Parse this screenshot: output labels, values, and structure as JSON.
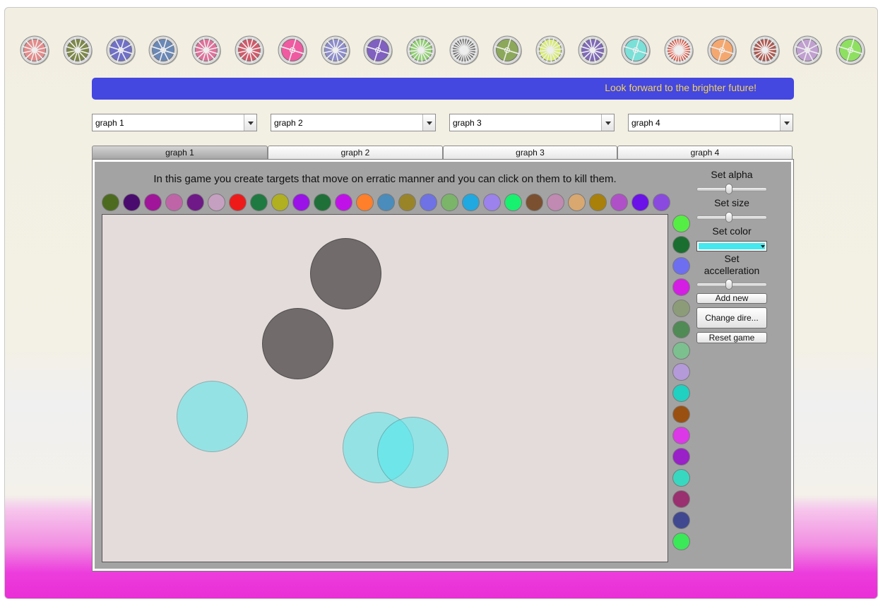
{
  "wheels": [
    {
      "icon": "wheel-icon",
      "color": "#e58a8a",
      "spokes": 6
    },
    {
      "icon": "wheel-icon",
      "color": "#7d8848",
      "spokes": 6
    },
    {
      "icon": "wheel-icon",
      "color": "#7070c7",
      "spokes": 4
    },
    {
      "icon": "wheel-icon",
      "color": "#6a88b5",
      "spokes": 4
    },
    {
      "icon": "wheel-icon",
      "color": "#e0709a",
      "spokes": 6
    },
    {
      "icon": "wheel-icon",
      "color": "#d05a6a",
      "spokes": 6
    },
    {
      "icon": "wheel-icon",
      "color": "#f05aa0",
      "spokes": 2
    },
    {
      "icon": "wheel-icon",
      "color": "#8c8ccc",
      "spokes": 6
    },
    {
      "icon": "wheel-icon",
      "color": "#8060c0",
      "spokes": 2
    },
    {
      "icon": "wheel-icon",
      "color": "#8fd070",
      "spokes": 8
    },
    {
      "icon": "wheel-icon",
      "color": "#777777",
      "spokes": 12
    },
    {
      "icon": "wheel-icon",
      "color": "#8ca85a",
      "spokes": 2
    },
    {
      "icon": "wheel-icon",
      "color": "#d8ec70",
      "spokes": 8
    },
    {
      "icon": "wheel-icon",
      "color": "#7f6ab8",
      "spokes": 6
    },
    {
      "icon": "wheel-icon",
      "color": "#7ae0d8",
      "spokes": 2
    },
    {
      "icon": "wheel-icon",
      "color": "#e25a48",
      "spokes": 12
    },
    {
      "icon": "wheel-icon",
      "color": "#f4a870",
      "spokes": 2
    },
    {
      "icon": "wheel-icon",
      "color": "#b05a50",
      "spokes": 8
    },
    {
      "icon": "wheel-icon",
      "color": "#c0a0d0",
      "spokes": 4
    },
    {
      "icon": "wheel-icon",
      "color": "#8ee060",
      "spokes": 2
    }
  ],
  "banner": {
    "text": "Look forward to the brighter future!",
    "bg": "#4447e0",
    "fg": "#f2d25a"
  },
  "combos": [
    {
      "value": "graph 1"
    },
    {
      "value": "graph 2"
    },
    {
      "value": "graph 3"
    },
    {
      "value": "graph 4"
    }
  ],
  "tabs": [
    {
      "label": "graph 1",
      "active": true
    },
    {
      "label": "graph 2",
      "active": false
    },
    {
      "label": "graph 3",
      "active": false
    },
    {
      "label": "graph 4",
      "active": false
    }
  ],
  "game": {
    "instructions": "In this game you create targets that move on erratic manner and you can click on them to kill them.",
    "top_palette": [
      "#4d6b1f",
      "#4a0b6e",
      "#a0159a",
      "#c064a8",
      "#6f1888",
      "#c6a0c0",
      "#ee1a1a",
      "#1e7a40",
      "#b0b020",
      "#9a12e8",
      "#1e7038",
      "#c012e8",
      "#ff7f2a",
      "#4a8cbc",
      "#9a8428",
      "#6e72e4",
      "#7ab56a",
      "#20a8e0",
      "#9c82ec",
      "#18f070",
      "#7a5030",
      "#c08ab2",
      "#d8a870",
      "#a8800a",
      "#b050c8",
      "#6a12e8",
      "#8a4ae0"
    ],
    "side_palette": [
      "#55ee44",
      "#1a6e30",
      "#6e6ef0",
      "#d41ee4",
      "#8c9c78",
      "#508a55",
      "#7cc090",
      "#b49ad8",
      "#20d0c0",
      "#9a5010",
      "#dc38e8",
      "#9a20c8",
      "#38d8c0",
      "#9a3070",
      "#404890",
      "#3ae858"
    ],
    "targets": [
      {
        "color": "#716b6b",
        "alpha": 1.0
      },
      {
        "color": "#716b6b",
        "alpha": 1.0
      },
      {
        "color": "#48e8ee",
        "alpha": 0.5
      },
      {
        "color": "#48e8ee",
        "alpha": 0.5
      },
      {
        "color": "#48e8ee",
        "alpha": 0.5
      }
    ]
  },
  "controls": {
    "alpha_label": "Set alpha",
    "alpha_level": 0.45,
    "size_label": "Set size",
    "size_level": 0.45,
    "color_label": "Set color",
    "color_value": "#44e8ee",
    "accel_label_1": "Set",
    "accel_label_2": "accelleration",
    "accel_level": 0.45,
    "add_new": "Add new",
    "change_dir": "Change dire...",
    "reset": "Reset game"
  }
}
